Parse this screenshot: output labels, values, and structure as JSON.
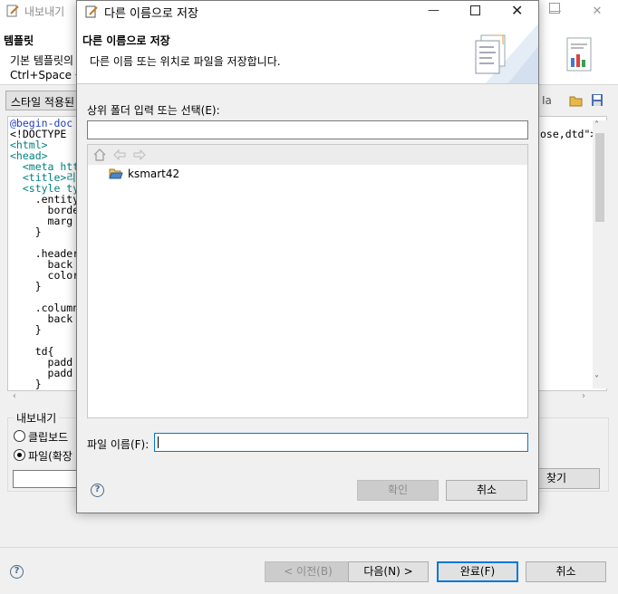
{
  "background_window": {
    "title": "내보내기",
    "section_title": "템플릿",
    "description_line1": "기본 템플릿의",
    "description_line2": "Ctrl+Space 를",
    "style_button_label": "스타일 적용된",
    "code_lines": [
      {
        "text": "@begin-doc",
        "tone": "blue"
      },
      {
        "text": "<!DOCTYPE",
        "tone": "black"
      },
      {
        "text": "<html>",
        "tone": "green"
      },
      {
        "text": "<head>",
        "tone": "green"
      },
      {
        "text": "  <meta http",
        "tone": "green"
      },
      {
        "text": "  <title>리포",
        "tone": "green"
      },
      {
        "text": "  <style type",
        "tone": "green"
      },
      {
        "text": "    .entity{",
        "tone": "black"
      },
      {
        "text": "      borde",
        "tone": "black"
      },
      {
        "text": "      marg",
        "tone": "black"
      },
      {
        "text": "    }",
        "tone": "black"
      },
      {
        "text": "",
        "tone": "black"
      },
      {
        "text": "    .header",
        "tone": "black"
      },
      {
        "text": "      back",
        "tone": "black"
      },
      {
        "text": "      color",
        "tone": "black"
      },
      {
        "text": "    }",
        "tone": "black"
      },
      {
        "text": "",
        "tone": "black"
      },
      {
        "text": "    .column",
        "tone": "black"
      },
      {
        "text": "      back",
        "tone": "black"
      },
      {
        "text": "    }",
        "tone": "black"
      },
      {
        "text": "",
        "tone": "black"
      },
      {
        "text": "    td{",
        "tone": "black"
      },
      {
        "text": "      padd",
        "tone": "black"
      },
      {
        "text": "      padd",
        "tone": "black"
      },
      {
        "text": "    }",
        "tone": "black"
      }
    ],
    "code_right_fragment": "ose,dtd\">",
    "export_group_label": "내보내기",
    "radio_clipboard": "클립보드",
    "radio_file": "파일(확장",
    "browse_button": "찾기",
    "back_button": "< 이전(B)",
    "next_button": "다음(N) >",
    "finish_button": "완료(F)",
    "cancel_button": "취소"
  },
  "dialog": {
    "title": "다른 이름으로 저장",
    "header_title": "다른 이름으로 저장",
    "header_desc": "다른 이름 또는 위치로 파일을 저장합니다.",
    "parent_folder_label": "상위 폴더 입력 또는 선택(E):",
    "parent_folder_value": "",
    "tree_items": [
      {
        "label": "ksmart42"
      }
    ],
    "filename_label": "파일 이름(F):",
    "filename_value": "",
    "ok_button": "확인",
    "cancel_button": "취소"
  },
  "icons": {
    "window_controls": [
      "minimize-icon",
      "maximize-icon",
      "close-icon"
    ],
    "tree_nav": [
      "home-icon",
      "back-arrow-icon",
      "forward-arrow-icon"
    ],
    "help": "help-icon",
    "folder": "open-folder-icon"
  },
  "colors": {
    "accent": "#0078d7",
    "window_bg": "#f0f0f0",
    "disabled_button": "#cccccc"
  }
}
